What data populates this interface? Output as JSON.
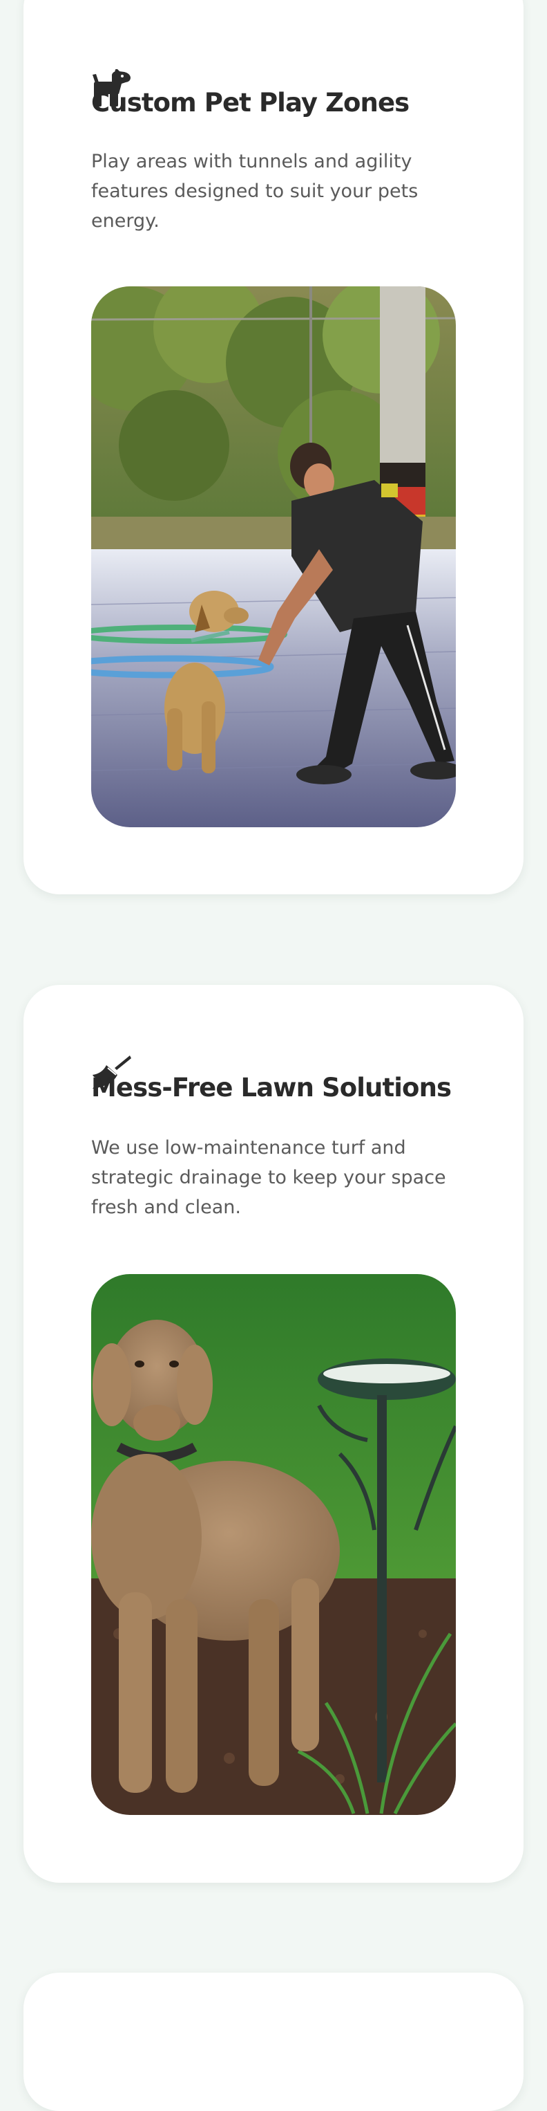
{
  "features": [
    {
      "icon": "dog-icon",
      "title": "Custom Pet Play Zones",
      "description": "Play areas with tunnels and agility features designed to suit your pets energy."
    },
    {
      "icon": "broom-icon",
      "title": "Mess-Free Lawn Solutions",
      "description": "We use low-maintenance turf and strategic drainage to keep your space fresh and clean."
    }
  ],
  "colors": {
    "page_background": "#f2f7f4",
    "card_background": "#ffffff",
    "heading": "#2a2a2a",
    "body_text": "#5a5a5a"
  }
}
